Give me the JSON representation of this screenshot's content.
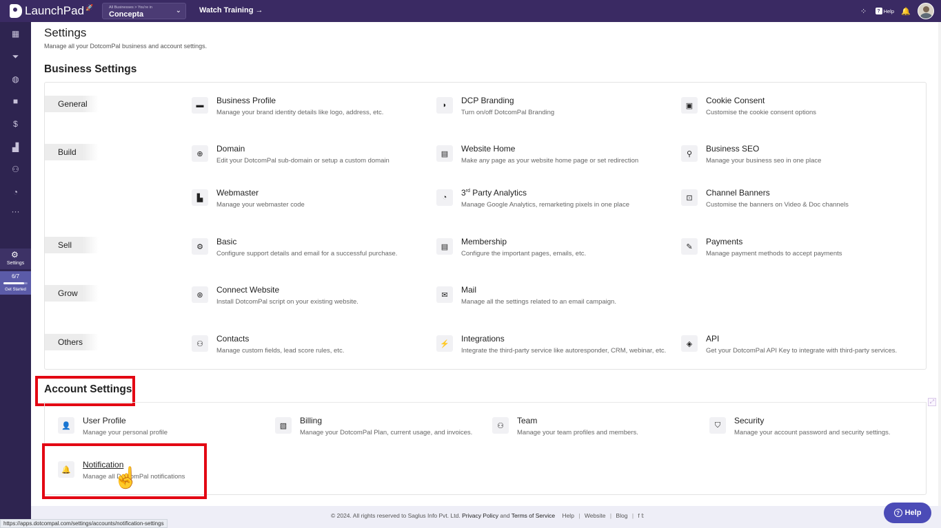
{
  "topbar": {
    "logo_text": "LaunchPad",
    "business_small": "All Businesses > You're in",
    "business_name": "Concepta",
    "watch_training": "Watch Training →",
    "help_label": "Help"
  },
  "sidebar": {
    "active_label": "Settings",
    "progress_text": "6/7",
    "progress_fraction": 0.86,
    "get_started_label": "Get Started"
  },
  "page": {
    "title": "Settings",
    "subtitle": "Manage all your DotcomPal business and account settings."
  },
  "business_settings": {
    "title": "Business Settings",
    "categories": [
      "General",
      "Build",
      "Sell",
      "Grow",
      "Others"
    ],
    "items": [
      {
        "title": "Business Profile",
        "desc": "Manage your brand identity details like logo, address, etc."
      },
      {
        "title": "DCP Branding",
        "desc": "Turn on/off DotcomPal Branding"
      },
      {
        "title": "Cookie Consent",
        "desc": "Customise the cookie consent options"
      },
      {
        "title": "Domain",
        "desc": "Edit your DotcomPal sub-domain or setup a custom domain"
      },
      {
        "title": "Website Home",
        "desc": "Make any page as your website home page or set redirection"
      },
      {
        "title": "Business SEO",
        "desc": "Manage your business seo in one place"
      },
      {
        "title": "Webmaster",
        "desc": "Manage your webmaster code"
      },
      {
        "title_prefix": "3",
        "title_sup": "rd",
        "title": " Party Analytics",
        "desc": "Manage Google Analytics, remarketing pixels in one place"
      },
      {
        "title": "Channel Banners",
        "desc": "Customise the banners on Video & Doc channels"
      },
      {
        "title": "Basic",
        "desc": "Configure support details and email for a successful purchase."
      },
      {
        "title": "Membership",
        "desc": "Configure the important pages, emails, etc."
      },
      {
        "title": "Payments",
        "desc": "Manage payment methods to accept payments"
      },
      {
        "title": "Connect Website",
        "desc": "Install DotcomPal script on your existing website."
      },
      {
        "title": "Mail",
        "desc": "Manage all the settings related to an email campaign."
      },
      {
        "title": "Contacts",
        "desc": "Manage custom fields, lead score rules, etc."
      },
      {
        "title": "Integrations",
        "desc": "Integrate the third-party service like autoresponder, CRM, webinar, etc."
      },
      {
        "title": "API",
        "desc": "Get your DotcomPal API Key to integrate with third-party services."
      }
    ]
  },
  "account_settings": {
    "title": "Account Settings",
    "items": [
      {
        "title": "User Profile",
        "desc": "Manage your personal profile"
      },
      {
        "title": "Billing",
        "desc": "Manage your DotcomPal Plan, current usage, and invoices."
      },
      {
        "title": "Team",
        "desc": "Manage your team profiles and members."
      },
      {
        "title": "Security",
        "desc": "Manage your account password and security settings."
      },
      {
        "title": "Notification",
        "desc": "Manage all DotcomPal notifications"
      }
    ]
  },
  "footer": {
    "copyright": "© 2024. All rights reserved to Saglus Info Pvt. Ltd.",
    "privacy": "Privacy Policy",
    "and": "and",
    "terms": "Terms of Service",
    "help": "Help",
    "website": "Website",
    "blog": "Blog",
    "status_url": "https://apps.dotcompal.com/settings/accounts/notification-settings",
    "help_button": "Help"
  },
  "colors": {
    "topbar": "#3a2a63",
    "sidebar": "#2e2450",
    "highlight_box": "#e30613",
    "help_button": "#4b4bb7"
  }
}
